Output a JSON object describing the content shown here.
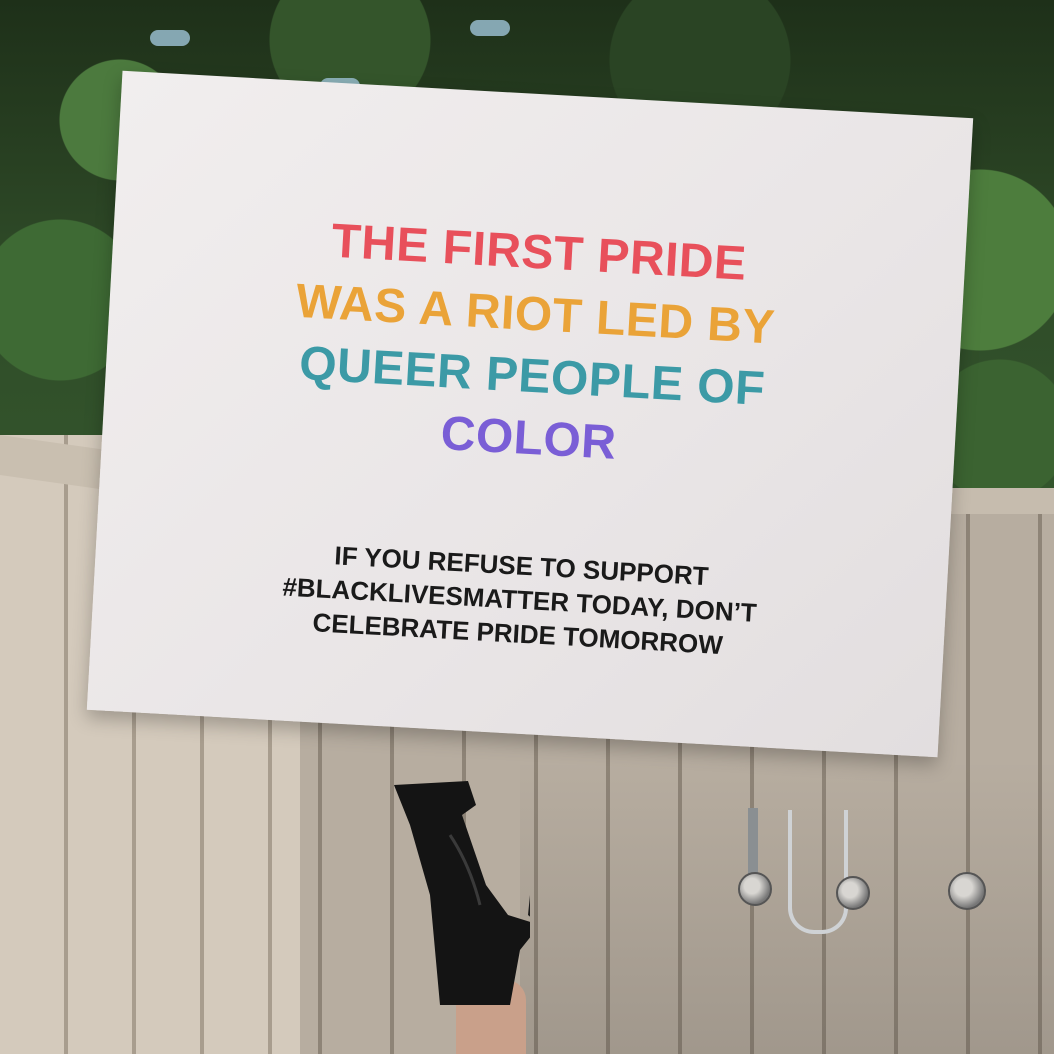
{
  "sign": {
    "headline": [
      "THE FIRST PRIDE",
      "WAS A RIOT LED BY",
      "QUEER PEOPLE OF",
      "COLOR"
    ],
    "subtext": [
      "IF YOU REFUSE TO SUPPORT",
      "#BLACKLIVESMATTER TODAY, DON’T",
      "CELEBRATE PRIDE TOMORROW"
    ]
  },
  "colors": {
    "headline_line_1": "#e8505b",
    "headline_line_2": "#eaa338",
    "headline_line_3": "#3c9aa6",
    "headline_line_4": "#7a5ed6",
    "subtext": "#1a1a1a",
    "sign_background": "#ece8e9"
  }
}
